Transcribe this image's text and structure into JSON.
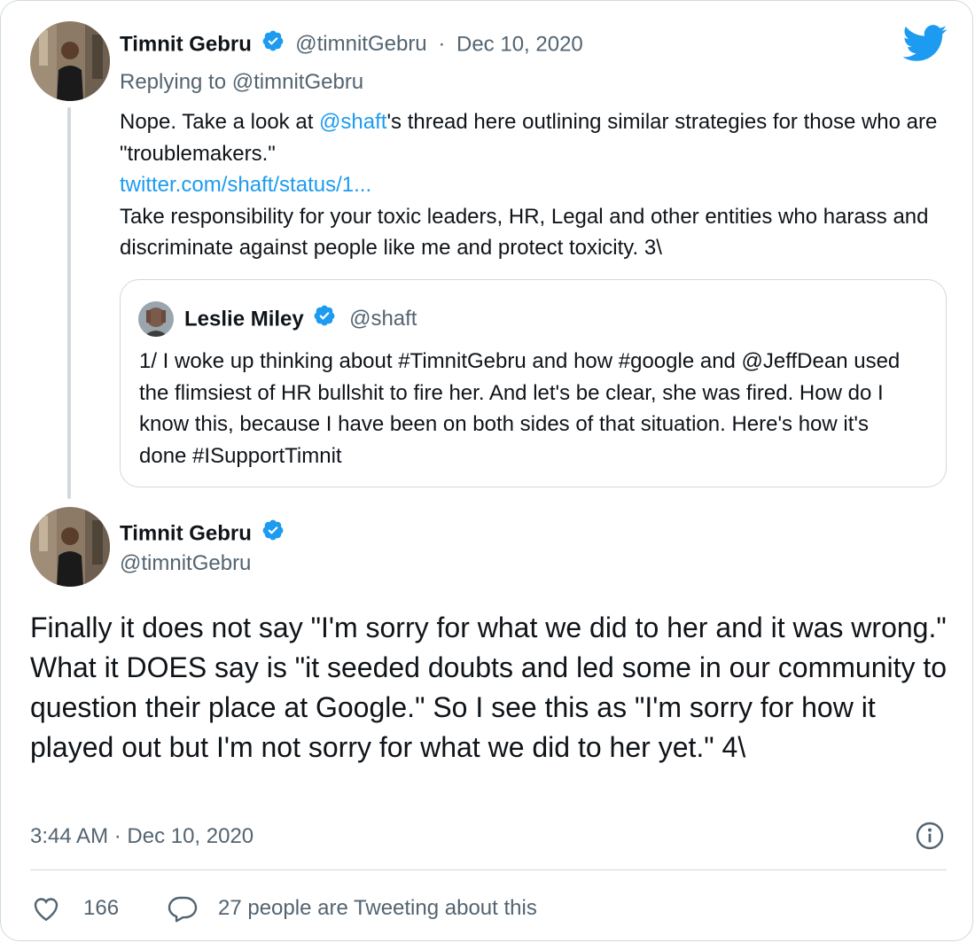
{
  "reply_tweet": {
    "author_name": "Timnit Gebru",
    "handle": "@timnitGebru",
    "separator": "·",
    "date": "Dec 10, 2020",
    "replying_to_prefix": "Replying to",
    "replying_to_handle": "@timnitGebru",
    "text_part1": "Nope. Take a look at ",
    "mention": "@shaft",
    "text_part2": "'s thread here outlining similar strategies for those who are \"troublemakers.\"",
    "link": "twitter.com/shaft/status/1...",
    "text_part3": "Take responsibility for your toxic leaders, HR, Legal and other entities who harass and discriminate against people like me and protect toxicity. 3\\"
  },
  "quoted_tweet": {
    "author_name": "Leslie Miley",
    "handle": "@shaft",
    "text": "1/ I woke up thinking about #TimnitGebru and how #google and @JeffDean used the flimsiest of HR bullshit to fire her. And let's be clear, she was fired. How do I know this, because I have been on both sides of that situation. Here's how it's done #ISupportTimnit"
  },
  "main_tweet": {
    "author_name": "Timnit Gebru",
    "handle": "@timnitGebru",
    "text": "Finally it does not say \"I'm sorry for what we did to her and it was wrong.\" What it DOES say is \"it seeded doubts and led some in our community to question their place at Google.\" So I see this as \"I'm sorry for how it played out but I'm not sorry for what we did to her yet.\" 4\\",
    "timestamp": "3:44 AM · Dec 10, 2020"
  },
  "actions": {
    "like_count": "166",
    "reply_text": "27 people are Tweeting about this"
  },
  "icons": {
    "twitter": "twitter-bird-icon",
    "verified": "verified-badge-icon",
    "info": "info-icon",
    "like": "heart-icon",
    "comment": "comment-icon"
  },
  "colors": {
    "accent": "#1d9bf0",
    "text": "#0f1419",
    "muted": "#536471",
    "border": "#cfd9de"
  }
}
